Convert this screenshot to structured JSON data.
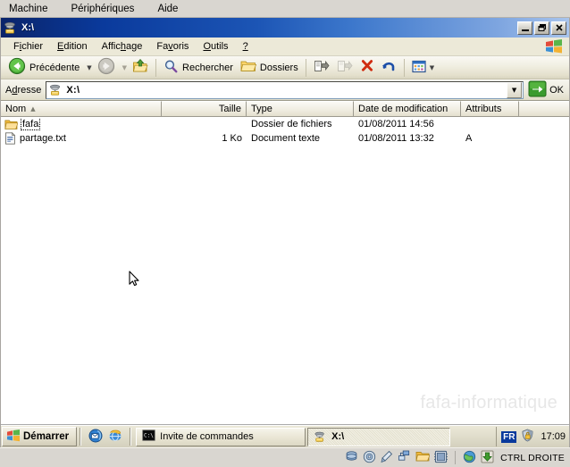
{
  "vbox": {
    "menu": [
      "Machine",
      "Périphériques",
      "Aide"
    ],
    "status": {
      "host_key": "CTRL DROITE",
      "icons": [
        "harddisk-icon",
        "cd-icon",
        "usb-icon",
        "network-icon",
        "folder-shared-icon",
        "display-icon",
        "globe-icon",
        "host-key-icon"
      ]
    }
  },
  "window": {
    "title": "X:\\",
    "icon": "network-drive-icon",
    "buttons": {
      "minimize": "_",
      "restore": "❐",
      "close": "✕"
    }
  },
  "menubar": {
    "items": [
      {
        "pre": "F",
        "key": "i",
        "post": "chier"
      },
      {
        "pre": "",
        "key": "E",
        "post": "dition"
      },
      {
        "pre": "Affic",
        "key": "h",
        "post": "age"
      },
      {
        "pre": "Fa",
        "key": "v",
        "post": "oris"
      },
      {
        "pre": "",
        "key": "O",
        "post": "utils"
      },
      {
        "pre": "",
        "key": "?",
        "post": ""
      }
    ],
    "logo": "windows-flag-icon"
  },
  "toolbar": {
    "back_label": "Précédente",
    "forward_label": "",
    "up_label": "",
    "search_label": "Rechercher",
    "folders_label": "Dossiers",
    "icons": [
      "back-arrow-icon",
      "forward-arrow-icon",
      "up-folder-icon",
      "search-icon",
      "folders-icon",
      "move-to-icon",
      "copy-to-icon",
      "delete-icon",
      "undo-icon",
      "views-icon"
    ]
  },
  "address": {
    "label_pre": "A",
    "label_key": "d",
    "label_post": "resse",
    "value": "X:\\",
    "icon": "network-drive-icon",
    "go_label": "OK"
  },
  "columns": [
    {
      "label": "Nom",
      "width": 180,
      "align": "left",
      "sorted": "asc",
      "sort_glyph": "▲"
    },
    {
      "label": "Taille",
      "width": 95,
      "align": "right",
      "sorted": "",
      "sort_glyph": ""
    },
    {
      "label": "Type",
      "width": 120,
      "align": "left",
      "sorted": "",
      "sort_glyph": ""
    },
    {
      "label": "Date de modification",
      "width": 120,
      "align": "left",
      "sorted": "",
      "sort_glyph": ""
    },
    {
      "label": "Attributs",
      "width": 65,
      "align": "left",
      "sorted": "",
      "sort_glyph": ""
    }
  ],
  "files": [
    {
      "name": "fafa",
      "icon": "folder-icon",
      "size": "",
      "type": "Dossier de fichiers",
      "modified": "01/08/2011 14:56",
      "attributes": "",
      "focused": true
    },
    {
      "name": "partage.txt",
      "icon": "text-file-icon",
      "size": "1 Ko",
      "type": "Document texte",
      "modified": "01/08/2011 13:32",
      "attributes": "A",
      "focused": false
    }
  ],
  "watermark": "fafa-informatique",
  "taskbar": {
    "start_label": "Démarrer",
    "quick_launch": [
      "outlook-express-icon",
      "internet-explorer-icon"
    ],
    "tasks": [
      {
        "label": "Invite de commandes",
        "icon": "console-icon",
        "active": false
      },
      {
        "label": "X:\\",
        "icon": "network-drive-icon",
        "active": true
      }
    ],
    "language": "FR",
    "tray_icon": "security-center-icon",
    "clock": "17:09"
  },
  "colors": {
    "titlebar_blue": "#0a246a",
    "folder_yellow": "#fcc75b",
    "desktop_beige": "#ece9d8",
    "accent_green": "#3a9b2e",
    "delete_red": "#cc2200"
  }
}
